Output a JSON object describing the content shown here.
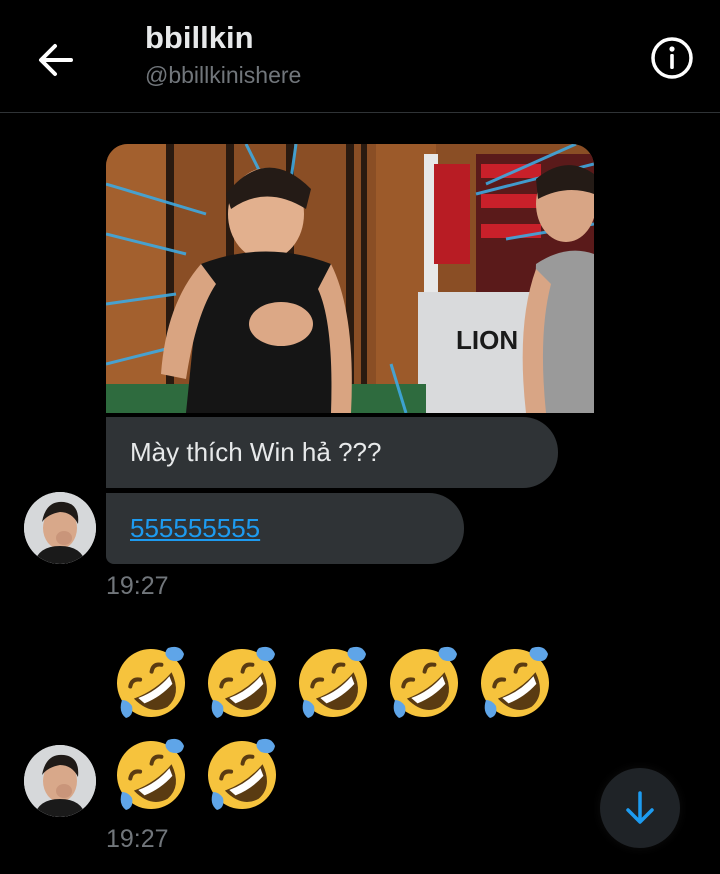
{
  "header": {
    "title": "bbillkin",
    "handle": "@bbillkinishere",
    "back_icon": "back-arrow-icon",
    "info_icon": "info-icon"
  },
  "messages": {
    "photo": {
      "sign_text": "LION"
    },
    "bubble_1_text": "Mày thích Win hả ???",
    "bubble_2_link": "555555555",
    "time_1": "19:27",
    "emoji_name": "rolling-on-the-floor-laughing-emoji",
    "emoji_count": 7,
    "time_2": "19:27"
  },
  "scroll_button_icon": "arrow-down-icon",
  "colors": {
    "background": "#000000",
    "bubble": "#2f3336",
    "link": "#1d9bf0",
    "muted": "#71767b"
  }
}
